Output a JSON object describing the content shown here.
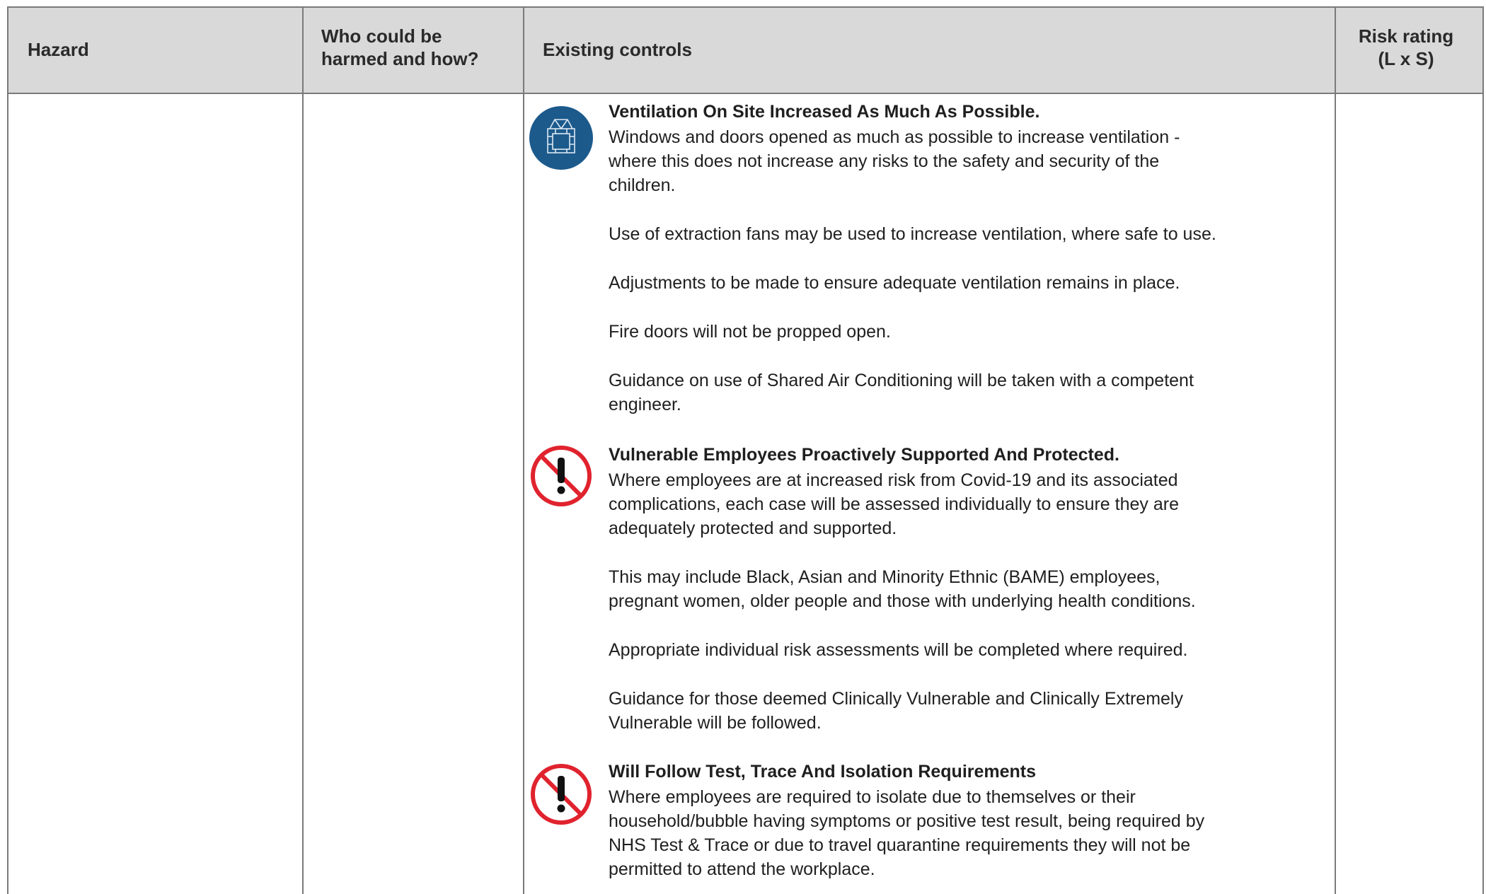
{
  "headers": {
    "hazard": "Hazard",
    "who": "Who could be\nharmed and how?",
    "controls": "Existing controls",
    "risk": "Risk rating\n(L x S)"
  },
  "controls": [
    {
      "icon": "ventilation-icon",
      "title": "Ventilation On Site Increased As Much As Possible.",
      "paragraphs": [
        "Windows and doors opened as much as possible to increase ventilation -\nwhere this does not increase any risks to the safety and security of the\nchildren.",
        "Use of extraction fans may be used to increase ventilation, where safe to use.",
        "Adjustments to be made to ensure adequate ventilation remains in place.",
        "Fire doors will not be propped open.",
        "Guidance on use of Shared Air Conditioning will be taken with a competent\nengineer."
      ]
    },
    {
      "icon": "prohibition-warning-icon",
      "title": "Vulnerable Employees Proactively Supported And Protected.",
      "paragraphs": [
        "Where employees are at increased risk from Covid-19 and its associated\ncomplications, each case will be assessed individually to ensure they are\nadequately protected and supported.",
        "This may include Black, Asian and Minority Ethnic (BAME) employees,\npregnant women, older people and those with underlying health conditions.",
        "Appropriate individual risk assessments will be completed where required.",
        "Guidance for those deemed Clinically Vulnerable and Clinically Extremely\nVulnerable will be followed."
      ]
    },
    {
      "icon": "prohibition-warning-icon",
      "title": "Will Follow Test, Trace And Isolation Requirements",
      "paragraphs": [
        "Where employees are required to isolate due to themselves or their\nhousehold/bubble having symptoms or positive test result, being required by\nNHS Test & Trace or due to travel quarantine requirements they will not be\npermitted to attend the workplace."
      ]
    }
  ],
  "colors": {
    "header_bg": "#d9d9d9",
    "border": "#7a7a7a",
    "ventilation_icon": "#1c5a8c",
    "prohibition_icon": "#e0232e"
  }
}
